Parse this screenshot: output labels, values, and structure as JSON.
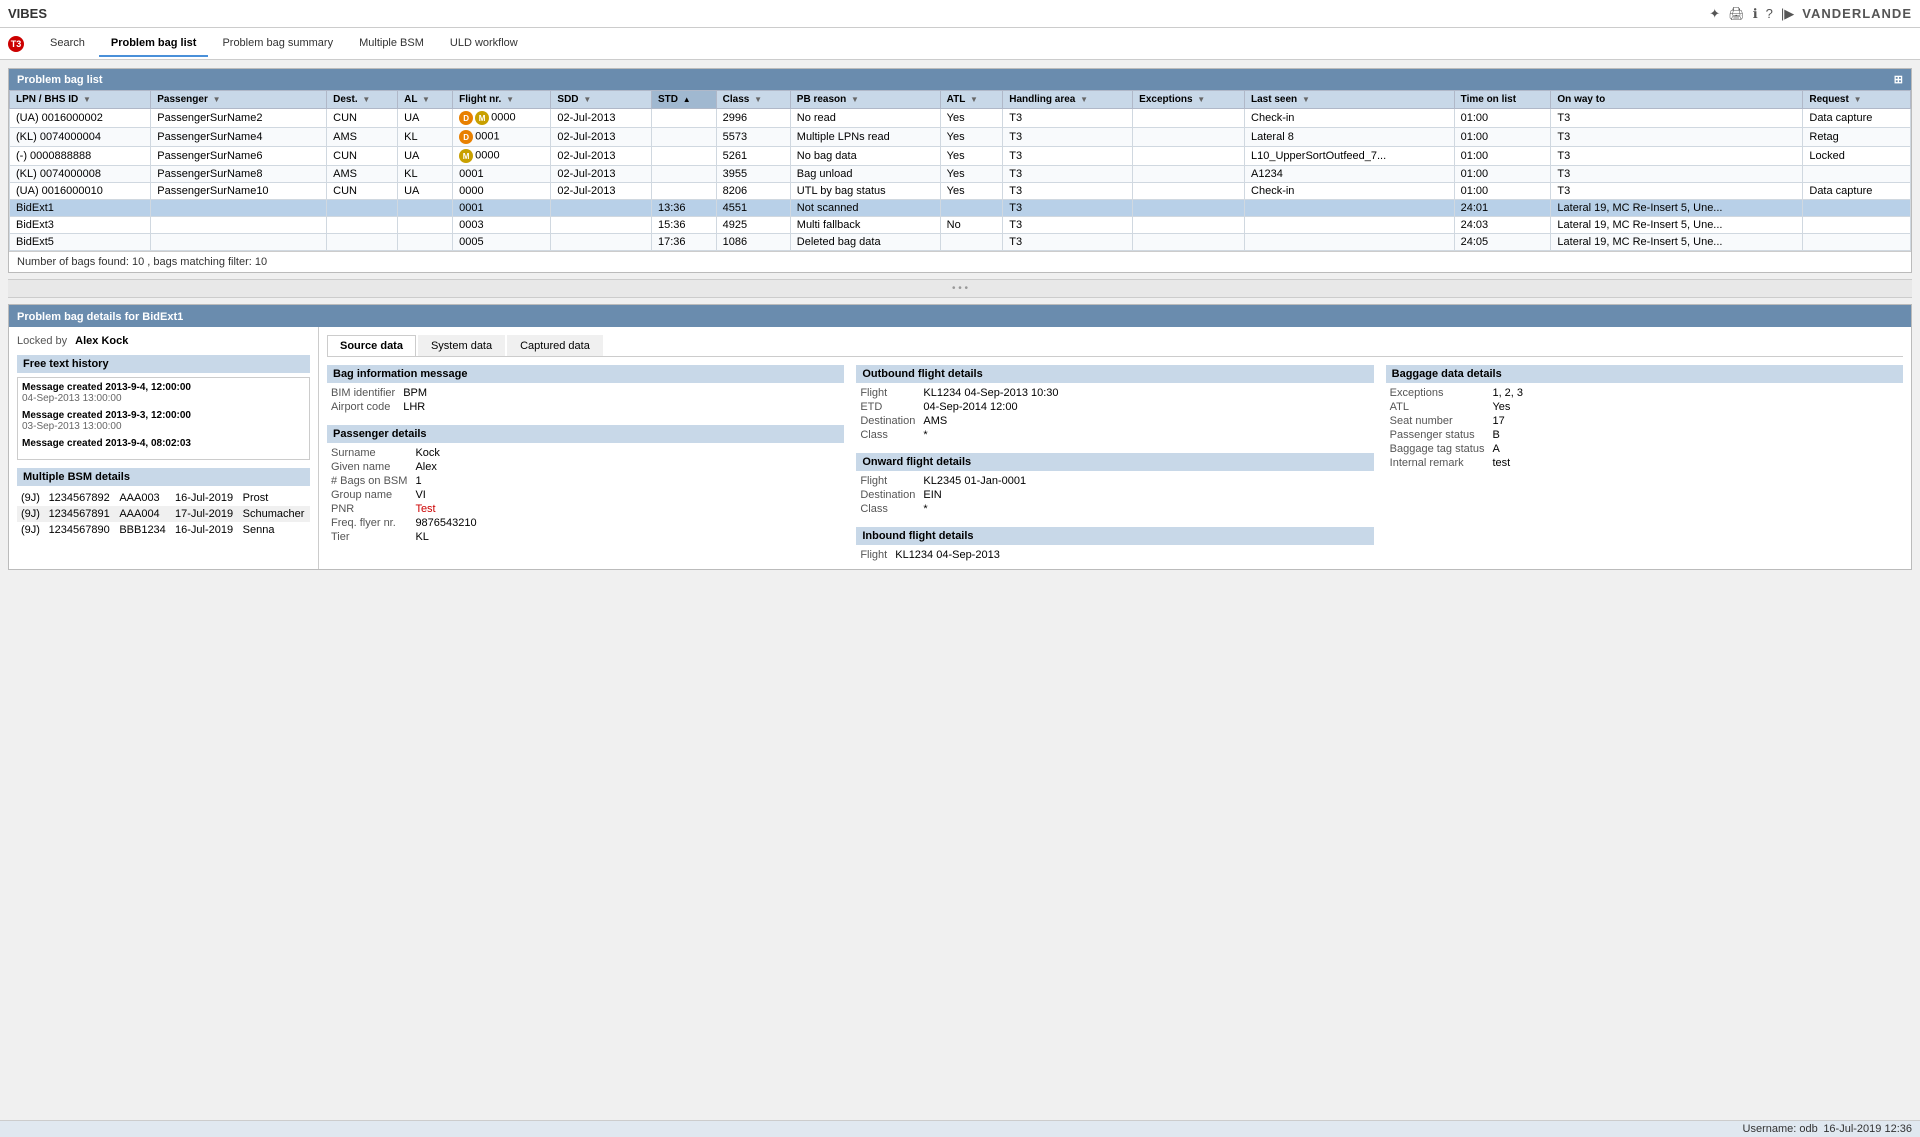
{
  "app": {
    "title": "VIBES",
    "logo": "VANDERLANDE"
  },
  "topbar": {
    "icons": [
      "sun-icon",
      "print-icon",
      "info-icon",
      "question-icon",
      "arrow-icon"
    ],
    "status_text": "Username: odb",
    "datetime": "16-Jul-2019 12:36"
  },
  "nav": {
    "t3_label": "T3",
    "tabs": [
      {
        "id": "search",
        "label": "Search",
        "active": false
      },
      {
        "id": "problem-bag-list",
        "label": "Problem bag list",
        "active": true
      },
      {
        "id": "problem-bag-summary",
        "label": "Problem bag summary",
        "active": false
      },
      {
        "id": "multiple-bsm",
        "label": "Multiple BSM",
        "active": false
      },
      {
        "id": "uld-workflow",
        "label": "ULD workflow",
        "active": false
      }
    ]
  },
  "problem_bag_list": {
    "title": "Problem bag list",
    "columns": [
      {
        "id": "lpn",
        "label": "LPN / BHS ID",
        "sortable": true,
        "filterable": true
      },
      {
        "id": "passenger",
        "label": "Passenger",
        "sortable": true,
        "filterable": true
      },
      {
        "id": "dest",
        "label": "Dest.",
        "sortable": true,
        "filterable": true
      },
      {
        "id": "al",
        "label": "AL",
        "sortable": true,
        "filterable": true
      },
      {
        "id": "flight",
        "label": "Flight nr.",
        "sortable": true,
        "filterable": true
      },
      {
        "id": "sdd",
        "label": "SDD",
        "sortable": true,
        "filterable": true
      },
      {
        "id": "std",
        "label": "STD",
        "sortable": true,
        "filterable": true,
        "sorted": true,
        "sort_dir": "asc"
      },
      {
        "id": "class",
        "label": "Class",
        "sortable": true,
        "filterable": true
      },
      {
        "id": "pb_reason",
        "label": "PB reason",
        "sortable": true,
        "filterable": true
      },
      {
        "id": "atl",
        "label": "ATL",
        "sortable": true,
        "filterable": true
      },
      {
        "id": "handling_area",
        "label": "Handling area",
        "sortable": true,
        "filterable": true
      },
      {
        "id": "exceptions",
        "label": "Exceptions",
        "sortable": true,
        "filterable": true
      },
      {
        "id": "last_seen",
        "label": "Last seen",
        "sortable": true,
        "filterable": true
      },
      {
        "id": "time_on_list",
        "label": "Time on list",
        "sortable": false,
        "filterable": false
      },
      {
        "id": "on_way_to",
        "label": "On way to",
        "sortable": false,
        "filterable": false
      },
      {
        "id": "request",
        "label": "Request",
        "sortable": false,
        "filterable": true
      }
    ],
    "rows": [
      {
        "lpn": "(UA) 0016000002",
        "passenger": "PassengerSurName2",
        "dest": "CUN",
        "al": "UA",
        "flight": "0000",
        "badges": [
          "D",
          "M"
        ],
        "sdd": "02-Jul-2013",
        "std": "",
        "class": "2996",
        "pb_reason": "No read",
        "atl": "Yes",
        "handling_area": "T3",
        "exceptions": "",
        "last_seen": "Check-in",
        "time_on_list": "01:00",
        "on_way_to": "T3",
        "request": "Data capture",
        "selected": false
      },
      {
        "lpn": "(KL) 0074000004",
        "passenger": "PassengerSurName4",
        "dest": "AMS",
        "al": "KL",
        "flight": "0001",
        "badges": [
          "D"
        ],
        "sdd": "02-Jul-2013",
        "std": "",
        "class": "5573",
        "pb_reason": "Multiple LPNs read",
        "atl": "Yes",
        "handling_area": "T3",
        "exceptions": "",
        "last_seen": "Lateral 8",
        "time_on_list": "01:00",
        "on_way_to": "T3",
        "request": "Retag",
        "selected": false
      },
      {
        "lpn": "(-) 0000888888",
        "passenger": "PassengerSurName6",
        "dest": "CUN",
        "al": "UA",
        "flight": "0000",
        "badges": [
          "M"
        ],
        "sdd": "02-Jul-2013",
        "std": "",
        "class": "5261",
        "pb_reason": "No bag data",
        "atl": "Yes",
        "handling_area": "T3",
        "exceptions": "",
        "last_seen": "L10_UpperSortOutfeed_7...",
        "time_on_list": "01:00",
        "on_way_to": "T3",
        "request": "Locked",
        "selected": false
      },
      {
        "lpn": "(KL) 0074000008",
        "passenger": "PassengerSurName8",
        "dest": "AMS",
        "al": "KL",
        "flight": "0001",
        "badges": [],
        "sdd": "02-Jul-2013",
        "std": "",
        "class": "3955",
        "pb_reason": "Bag unload",
        "atl": "Yes",
        "handling_area": "T3",
        "exceptions": "",
        "last_seen": "A1234",
        "time_on_list": "01:00",
        "on_way_to": "T3",
        "request": "",
        "selected": false
      },
      {
        "lpn": "(UA) 0016000010",
        "passenger": "PassengerSurName10",
        "dest": "CUN",
        "al": "UA",
        "flight": "0000",
        "badges": [],
        "sdd": "02-Jul-2013",
        "std": "",
        "class": "8206",
        "pb_reason": "UTL by bag status",
        "atl": "Yes",
        "handling_area": "T3",
        "exceptions": "",
        "last_seen": "Check-in",
        "time_on_list": "01:00",
        "on_way_to": "T3",
        "request": "Data capture",
        "selected": false
      },
      {
        "lpn": "BidExt1",
        "passenger": "",
        "dest": "",
        "al": "",
        "flight": "0001",
        "badges": [],
        "sdd": "",
        "std": "13:36",
        "class": "4551",
        "pb_reason": "Not scanned",
        "atl": "",
        "handling_area": "T3",
        "exceptions": "",
        "last_seen": "",
        "time_on_list": "24:01",
        "on_way_to": "Lateral 19, MC Re-Insert 5, Une...",
        "request": "",
        "selected": true
      },
      {
        "lpn": "BidExt3",
        "passenger": "",
        "dest": "",
        "al": "",
        "flight": "0003",
        "badges": [],
        "sdd": "",
        "std": "15:36",
        "class": "4925",
        "pb_reason": "Multi fallback",
        "atl": "No",
        "handling_area": "T3",
        "exceptions": "",
        "last_seen": "",
        "time_on_list": "24:03",
        "on_way_to": "Lateral 19, MC Re-Insert 5, Une...",
        "request": "",
        "selected": false
      },
      {
        "lpn": "BidExt5",
        "passenger": "",
        "dest": "",
        "al": "",
        "flight": "0005",
        "badges": [],
        "sdd": "",
        "std": "17:36",
        "class": "1086",
        "pb_reason": "Deleted bag data",
        "atl": "",
        "handling_area": "T3",
        "exceptions": "",
        "last_seen": "",
        "time_on_list": "24:05",
        "on_way_to": "Lateral 19, MC Re-Insert 5, Une...",
        "request": "",
        "selected": false
      }
    ],
    "footer": {
      "bags_found_label": "Number of bags found:",
      "bags_found_count": "10",
      "matching_label": ", bags matching filter:",
      "matching_count": "10"
    }
  },
  "detail": {
    "title": "Problem bag details for BidExt1",
    "locked_by_label": "Locked by",
    "locked_by_value": "Alex Kock",
    "tabs": [
      {
        "id": "source-data",
        "label": "Source data",
        "active": true
      },
      {
        "id": "system-data",
        "label": "System data",
        "active": false
      },
      {
        "id": "captured-data",
        "label": "Captured data",
        "active": false
      }
    ],
    "free_text_section": "Free text history",
    "free_text_items": [
      {
        "title": "Message created 2013-9-4, 12:00:00",
        "date": "04-Sep-2013 13:00:00"
      },
      {
        "title": "Message created 2013-9-3, 12:00:00",
        "date": "03-Sep-2013 13:00:00"
      },
      {
        "title": "Message created 2013-9-4, 08:02:03",
        "date": ""
      }
    ],
    "bsm_section": "Multiple BSM details",
    "bsm_items": [
      {
        "ref": "(9J)",
        "id": "1234567892",
        "code": "AAA003",
        "date": "16-Jul-2019",
        "name": "Prost"
      },
      {
        "ref": "(9J)",
        "id": "1234567891",
        "code": "AAA004",
        "date": "17-Jul-2019",
        "name": "Schumacher"
      },
      {
        "ref": "(9J)",
        "id": "1234567890",
        "code": "BBB1234",
        "date": "16-Jul-2019",
        "name": "Senna"
      }
    ],
    "bag_info_section": "Bag information message",
    "bim_identifier_label": "BIM identifier",
    "bim_identifier_value": "BPM",
    "airport_code_label": "Airport code",
    "airport_code_value": "LHR",
    "passenger_section": "Passenger details",
    "passenger_fields": [
      {
        "label": "Surname",
        "value": "Kock"
      },
      {
        "label": "Given name",
        "value": "Alex"
      },
      {
        "label": "# Bags on BSM",
        "value": "1"
      },
      {
        "label": "Group name",
        "value": "VI"
      },
      {
        "label": "PNR",
        "value": "Test",
        "highlight": true
      },
      {
        "label": "Freq. flyer nr.",
        "value": "9876543210"
      },
      {
        "label": "Tier",
        "value": "KL"
      }
    ],
    "outbound_section": "Outbound flight details",
    "outbound_fields": [
      {
        "label": "Flight",
        "value": "KL1234 04-Sep-2013 10:30"
      },
      {
        "label": "ETD",
        "value": "04-Sep-2014 12:00"
      },
      {
        "label": "Destination",
        "value": "AMS"
      },
      {
        "label": "Class",
        "value": "*"
      }
    ],
    "onward_section": "Onward flight details",
    "onward_fields": [
      {
        "label": "Flight",
        "value": "KL2345 01-Jan-0001"
      },
      {
        "label": "Destination",
        "value": "EIN"
      },
      {
        "label": "Class",
        "value": "*"
      }
    ],
    "inbound_section": "Inbound flight details",
    "inbound_fields": [
      {
        "label": "Flight",
        "value": "KL1234 04-Sep-2013"
      }
    ],
    "baggage_section": "Baggage data details",
    "baggage_fields": [
      {
        "label": "Exceptions",
        "value": "1, 2, 3"
      },
      {
        "label": "ATL",
        "value": "Yes"
      },
      {
        "label": "Seat number",
        "value": "17"
      },
      {
        "label": "Passenger status",
        "value": "B"
      },
      {
        "label": "Baggage tag status",
        "value": "A"
      },
      {
        "label": "Internal remark",
        "value": "test"
      }
    ]
  },
  "statusbar": {
    "username_label": "Username: odb",
    "datetime": "16-Jul-2019 12:36"
  }
}
